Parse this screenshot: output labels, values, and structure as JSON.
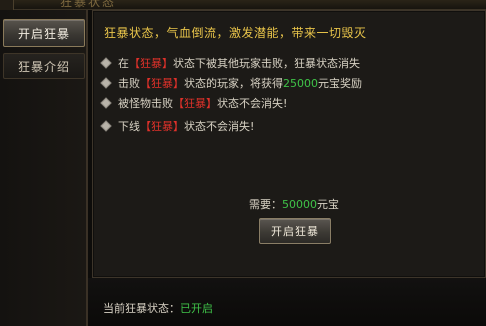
{
  "window": {
    "title": "狂暴状态"
  },
  "sidebar": {
    "items": [
      {
        "label": "开启狂暴",
        "active": true
      },
      {
        "label": "狂暴介绍",
        "active": false
      }
    ]
  },
  "panel": {
    "header": "狂暴状态，气血倒流，激发潜能，带来一切毁灭",
    "rules": [
      {
        "before": "在",
        "highlight": "【狂暴】",
        "after": "状态下被其他玩家击败，狂暴状态消失",
        "reward": "",
        "tail": ""
      },
      {
        "before": "击败",
        "highlight": "【狂暴】",
        "after": "状态的玩家，将获得",
        "reward": "25000",
        "tail": "元宝奖励"
      },
      {
        "before": "被怪物击败",
        "highlight": "【狂暴】",
        "after": "状态不会消失!",
        "reward": "",
        "tail": ""
      },
      {
        "before": "下线",
        "highlight": "【狂暴】",
        "after": "状态不会消失!",
        "reward": "",
        "tail": ""
      }
    ],
    "cost": {
      "label": "需要：",
      "amount": "50000",
      "unit": "元宝"
    },
    "open_button": "开启狂暴"
  },
  "status": {
    "label": "当前狂暴状态：",
    "value": "已开启"
  },
  "colors": {
    "header": "#e8c44a",
    "highlight": "#e0312a",
    "value": "#3fc248",
    "text": "#d8d2c4"
  }
}
